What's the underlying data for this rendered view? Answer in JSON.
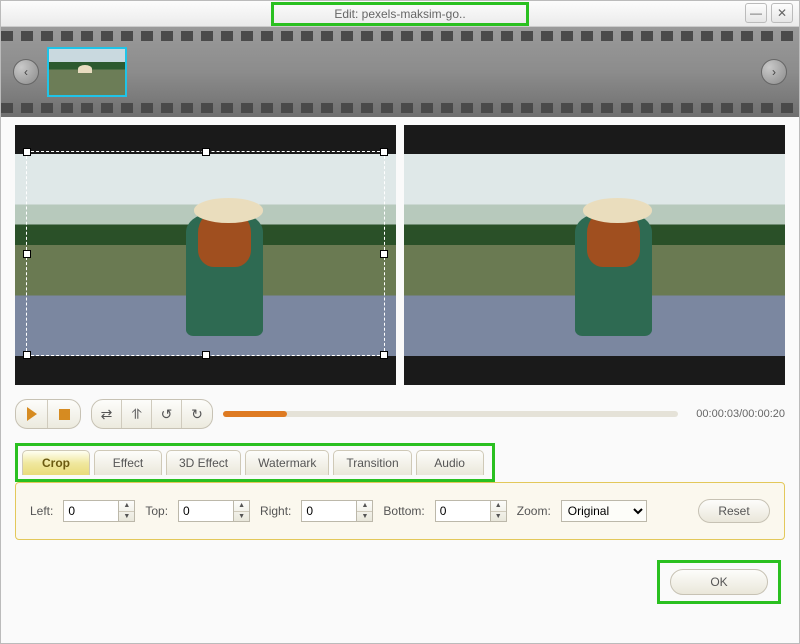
{
  "titlebar": {
    "title": "Edit: pexels-maksim-go.."
  },
  "playback": {
    "time": "00:00:03/00:00:20"
  },
  "tabs": {
    "items": [
      {
        "label": "Crop"
      },
      {
        "label": "Effect"
      },
      {
        "label": "3D Effect"
      },
      {
        "label": "Watermark"
      },
      {
        "label": "Transition"
      },
      {
        "label": "Audio"
      }
    ]
  },
  "crop": {
    "left_label": "Left:",
    "left_value": "0",
    "top_label": "Top:",
    "top_value": "0",
    "right_label": "Right:",
    "right_value": "0",
    "bottom_label": "Bottom:",
    "bottom_value": "0",
    "zoom_label": "Zoom:",
    "zoom_value": "Original",
    "reset_label": "Reset"
  },
  "footer": {
    "ok_label": "OK"
  }
}
